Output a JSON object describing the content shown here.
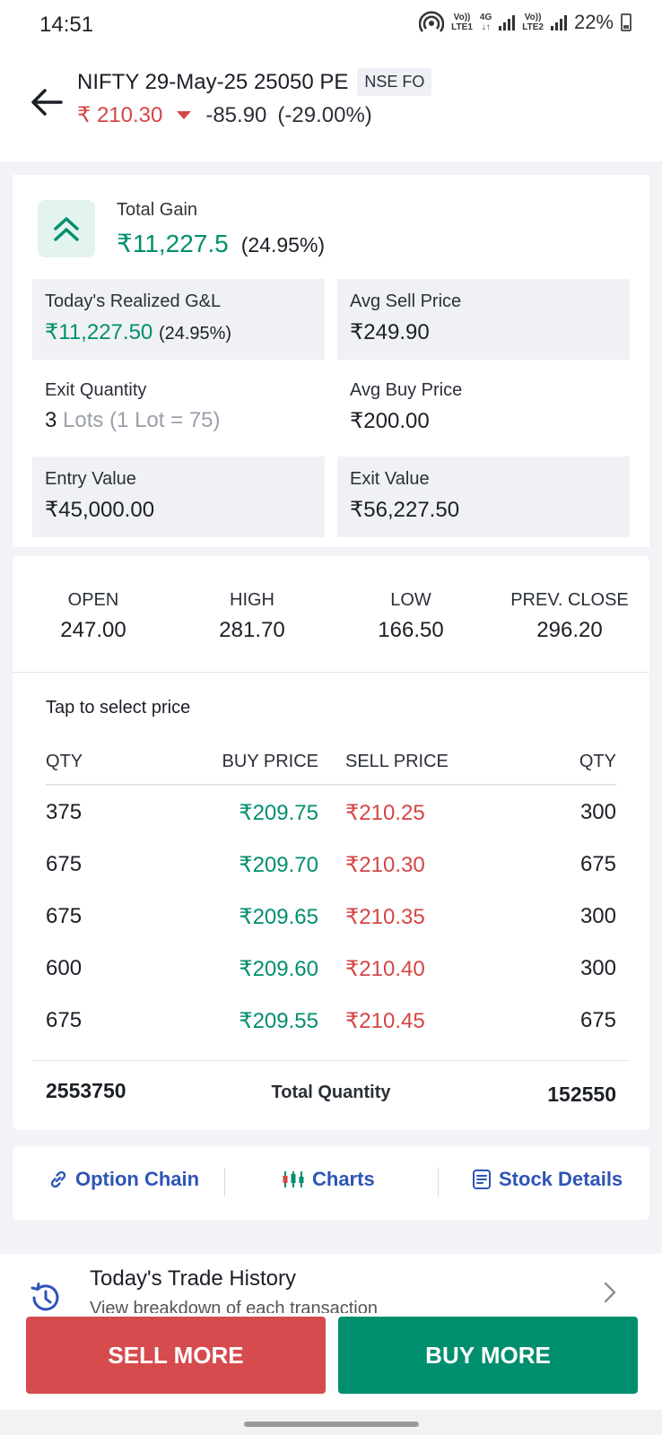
{
  "status_bar": {
    "time": "14:51",
    "sim1_top": "Vo))",
    "sim1_bottom": "LTE1",
    "net_top": "4G",
    "net_bottom": "↓↑",
    "sim2_top": "Vo))",
    "sim2_bottom": "LTE2",
    "battery": "22%"
  },
  "header": {
    "title": "NIFTY 29-May-25 25050 PE",
    "exchange": "NSE FO",
    "ltp": "₹ 210.30",
    "change": "-85.90",
    "change_pct": "(-29.00%)"
  },
  "gain": {
    "label": "Total Gain",
    "value": "₹11,227.5",
    "pct": "(24.95%)",
    "cells": {
      "realized_label": "Today's Realized G&L",
      "realized_value": "₹11,227.50",
      "realized_pct": "(24.95%)",
      "avg_sell_label": "Avg Sell Price",
      "avg_sell_value": "₹249.90",
      "exit_qty_label": "Exit Quantity",
      "exit_qty_value": "3",
      "exit_qty_note": "Lots (1 Lot = 75)",
      "avg_buy_label": "Avg Buy Price",
      "avg_buy_value": "₹200.00",
      "entry_value_label": "Entry Value",
      "entry_value_value": "₹45,000.00",
      "exit_value_label": "Exit Value",
      "exit_value_value": "₹56,227.50"
    }
  },
  "ohlc": {
    "open_label": "OPEN",
    "open": "247.00",
    "high_label": "HIGH",
    "high": "281.70",
    "low_label": "LOW",
    "low": "166.50",
    "prev_label": "PREV. CLOSE",
    "prev": "296.20"
  },
  "depth": {
    "hint": "Tap to select price",
    "headers": {
      "qty": "QTY",
      "buy": "BUY PRICE",
      "sell": "SELL PRICE",
      "qty2": "QTY"
    },
    "rows": [
      {
        "bid_qty": "375",
        "bid": "₹209.75",
        "ask": "₹210.25",
        "ask_qty": "300"
      },
      {
        "bid_qty": "675",
        "bid": "₹209.70",
        "ask": "₹210.30",
        "ask_qty": "675"
      },
      {
        "bid_qty": "675",
        "bid": "₹209.65",
        "ask": "₹210.35",
        "ask_qty": "300"
      },
      {
        "bid_qty": "600",
        "bid": "₹209.60",
        "ask": "₹210.40",
        "ask_qty": "300"
      },
      {
        "bid_qty": "675",
        "bid": "₹209.55",
        "ask": "₹210.45",
        "ask_qty": "675"
      }
    ],
    "total_bid": "2553750",
    "total_label": "Total Quantity",
    "total_ask": "152550"
  },
  "links": {
    "option_chain": "Option Chain",
    "charts": "Charts",
    "stock_details": "Stock Details"
  },
  "history": {
    "title": "Today's Trade History",
    "subtitle": "View breakdown of each transaction"
  },
  "actions": {
    "sell": "SELL MORE",
    "buy": "BUY MORE"
  }
}
